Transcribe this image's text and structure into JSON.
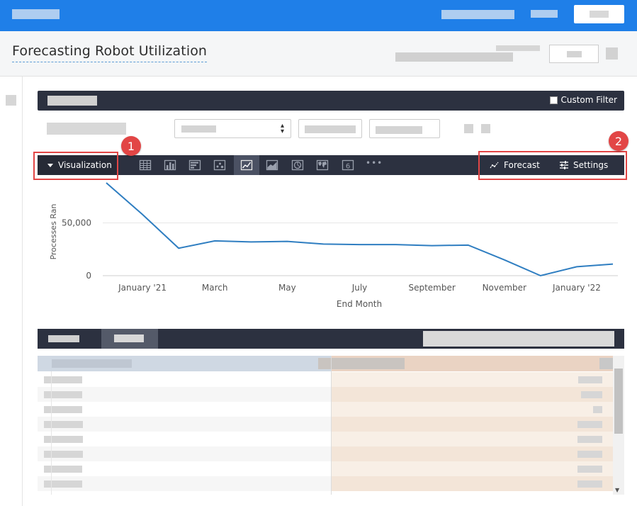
{
  "page": {
    "title": "Forecasting Robot Utilization"
  },
  "filter_bar": {
    "custom_filter_label": "Custom Filter"
  },
  "visualization_bar": {
    "toggle_label": "Visualization",
    "types": [
      "table",
      "column",
      "bar",
      "scatter",
      "line",
      "area",
      "pie",
      "map",
      "single-value",
      "more"
    ],
    "active_type": "line",
    "single_value_glyph": "6",
    "more_glyph": "•••",
    "forecast_label": "Forecast",
    "settings_label": "Settings"
  },
  "callouts": {
    "one": "1",
    "two": "2"
  },
  "colors": {
    "topbar": "#1f7fe8",
    "dark_bar": "#2c3140",
    "line": "#2f7ec1",
    "callout": "#e24646"
  },
  "chart_data": {
    "type": "line",
    "xlabel": "End Month",
    "ylabel": "Processes Ran",
    "ylim": [
      0,
      90000
    ],
    "yticks": [
      0,
      50000
    ],
    "ytick_labels": [
      "0",
      "50,000"
    ],
    "x_tick_labels": [
      "January '21",
      "March",
      "May",
      "July",
      "September",
      "November",
      "January '22"
    ],
    "x_tick_index": [
      1,
      3,
      5,
      7,
      9,
      11,
      13
    ],
    "x": [
      "Dec '20",
      "Jan '21",
      "Feb '21",
      "Mar '21",
      "Apr '21",
      "May '21",
      "Jun '21",
      "Jul '21",
      "Aug '21",
      "Sep '21",
      "Oct '21",
      "Nov '21",
      "Dec '21",
      "Jan '22",
      "Feb '22"
    ],
    "series": [
      {
        "values": [
          88000,
          58000,
          26000,
          33000,
          32000,
          32500,
          30000,
          29500,
          29500,
          28500,
          29000,
          15000,
          0,
          8500,
          11000
        ]
      }
    ]
  }
}
